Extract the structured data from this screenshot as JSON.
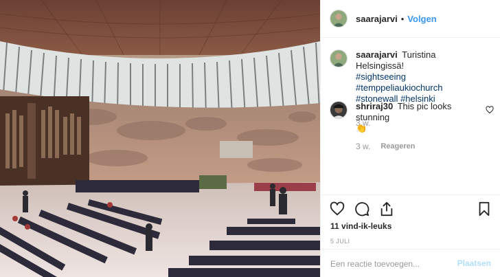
{
  "post": {
    "author": "saarajarvi",
    "separator": "•",
    "follow_label": "Volgen"
  },
  "caption": {
    "author": "saarajarvi",
    "text": "Turistina Helsingissä!",
    "hashtags": [
      "#sightseeing",
      "#temppeliaukiochurch",
      "#stonewall",
      "#helsinki"
    ],
    "time": "3 w."
  },
  "comments": [
    {
      "author": "shriraj30",
      "text": "This pic looks stunning",
      "emoji": "👏",
      "time": "3 w.",
      "reply_label": "Reageren"
    }
  ],
  "actions": {
    "icons": [
      "heart-icon",
      "comment-icon",
      "share-icon",
      "bookmark-icon"
    ],
    "likes": "11 vind-ik-leuks",
    "date": "5 JULI"
  },
  "add_comment": {
    "placeholder": "Een reactie toevoegen...",
    "post_label": "Plaatsen"
  },
  "colors": {
    "link": "#3897f0",
    "hashtag": "#003569",
    "muted": "#999999",
    "post_disabled": "#b2dffc"
  }
}
